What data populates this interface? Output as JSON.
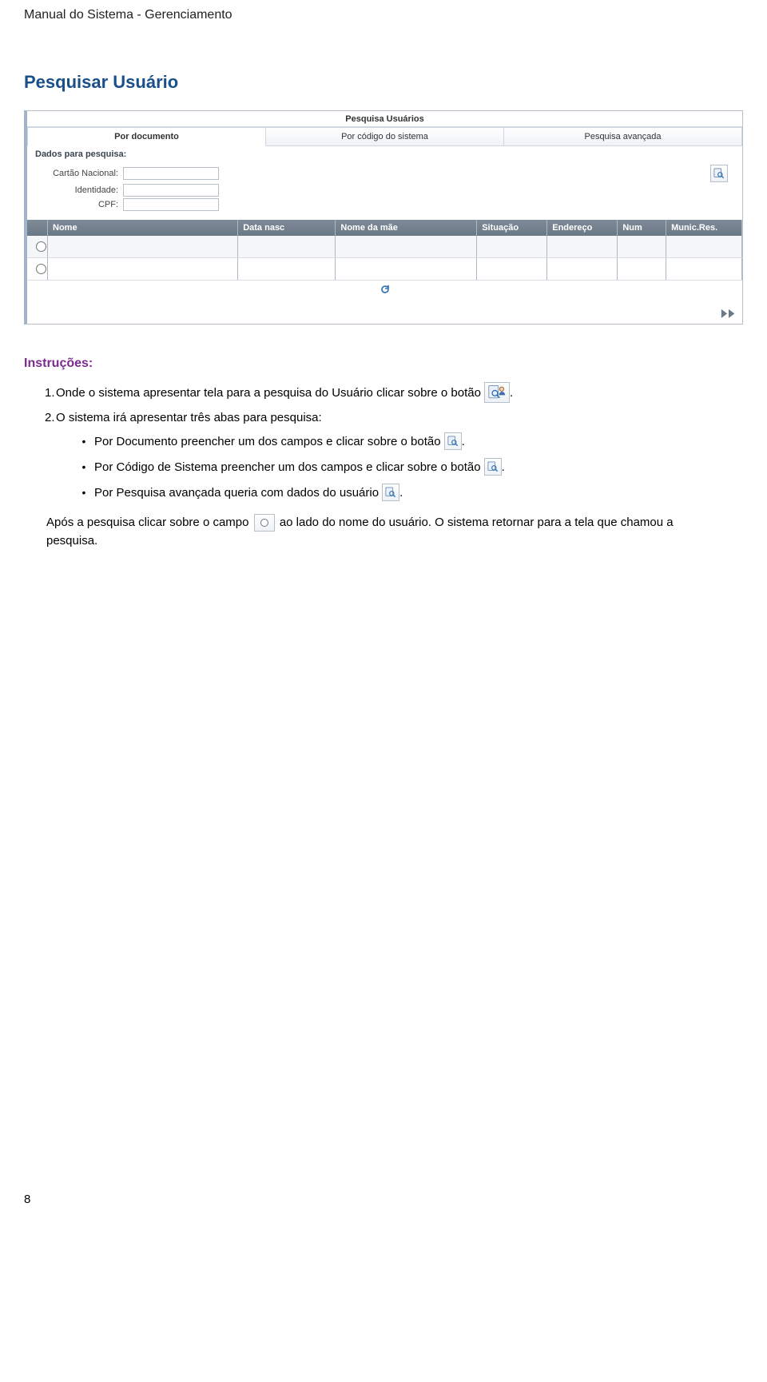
{
  "header": "Manual do Sistema - Gerenciamento",
  "section_title": "Pesquisar Usuário",
  "shot": {
    "title": "Pesquisa Usuários",
    "tabs": [
      "Por documento",
      "Por código do sistema",
      "Pesquisa avançada"
    ],
    "dados_label": "Dados para pesquisa:",
    "fields": {
      "cartao_label": "Cartão Nacional:",
      "identidade_label": "Identidade:",
      "cpf_label": "CPF:"
    },
    "grid_headers": [
      "Nome",
      "Data nasc",
      "Nome da mãe",
      "Situação",
      "Endereço",
      "Num",
      "Munic.Res."
    ]
  },
  "instructions": {
    "title": "Instruções:",
    "item1_num": "1.",
    "item1_text": "Onde o sistema apresentar tela para a pesquisa do Usuário clicar sobre o botão ",
    "item1_suffix": ".",
    "item2_num": "2.",
    "item2_text": "O sistema irá apresentar três abas para pesquisa:",
    "bullet1": "Por Documento preencher um dos campos e clicar sobre o botão ",
    "bullet1_suffix": ".",
    "bullet2": "Por Código de Sistema preencher um dos campos e clicar sobre o botão ",
    "bullet2_suffix": ".",
    "bullet3": "Por Pesquisa avançada queria com dados do usuário ",
    "bullet3_suffix": ".",
    "after_p1a": "Após a pesquisa clicar sobre o campo ",
    "after_p1b": " ao lado do nome do usuário. O sistema retornar para a tela que chamou a pesquisa."
  },
  "page_number": "8"
}
